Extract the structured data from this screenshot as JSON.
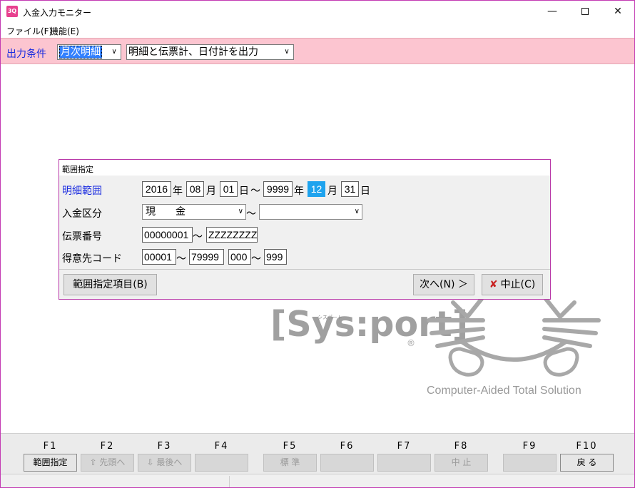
{
  "window": {
    "title": "入金入力モニター",
    "icon_text": "3Q"
  },
  "menu": {
    "file": "ファイル(F)",
    "function": "機能(E)"
  },
  "condition": {
    "label": "出力条件",
    "period_value": "月次明細",
    "output_value": "明細と伝票計、日付計を出力"
  },
  "dialog": {
    "title": "範囲指定",
    "rows": {
      "detail_range_label": "明細範囲",
      "deposit_type_label": "入金区分",
      "slip_no_label": "伝票番号",
      "customer_code_label": "得意先コード"
    },
    "date_from": {
      "year": "2016",
      "month": "08",
      "day": "01"
    },
    "date_to": {
      "year": "9999",
      "month": "12",
      "day": "31"
    },
    "units": {
      "year": "年",
      "month": "月",
      "day": "日",
      "tilde": "～"
    },
    "deposit_from": "現　　金",
    "deposit_to": "",
    "slip_from": "00000001",
    "slip_to": "ZZZZZZZZ",
    "customer_from": "00001",
    "customer_to": "79999",
    "sub_from": "000",
    "sub_to": "999",
    "buttons": {
      "range_items": "範囲指定項目(B)",
      "next": "次へ(N) ＞",
      "stop": "中止(C)"
    }
  },
  "logo": {
    "brand": "[Sys:port]",
    "brand_small": "シスポート",
    "registered": "®",
    "tagline": "Computer-Aided Total Solution"
  },
  "fkeys": [
    {
      "key": "F1",
      "label": "範囲指定",
      "enabled": true
    },
    {
      "key": "F2",
      "label": "⇧ 先頭へ",
      "enabled": false
    },
    {
      "key": "F3",
      "label": "⇩ 最後へ",
      "enabled": false
    },
    {
      "key": "F4",
      "label": "",
      "enabled": false
    },
    {
      "key": "F5",
      "label": "標 準",
      "enabled": false
    },
    {
      "key": "F6",
      "label": "",
      "enabled": false
    },
    {
      "key": "F7",
      "label": "",
      "enabled": false
    },
    {
      "key": "F8",
      "label": "中 止",
      "enabled": false
    },
    {
      "key": "F9",
      "label": "",
      "enabled": false
    },
    {
      "key": "F10",
      "label": "戻 る",
      "enabled": true
    }
  ],
  "colors": {
    "window_border": "#c33bb3",
    "condition_bar": "#fcc5d0",
    "label_blue": "#1a2be0",
    "highlight": "#1ea3ee"
  }
}
